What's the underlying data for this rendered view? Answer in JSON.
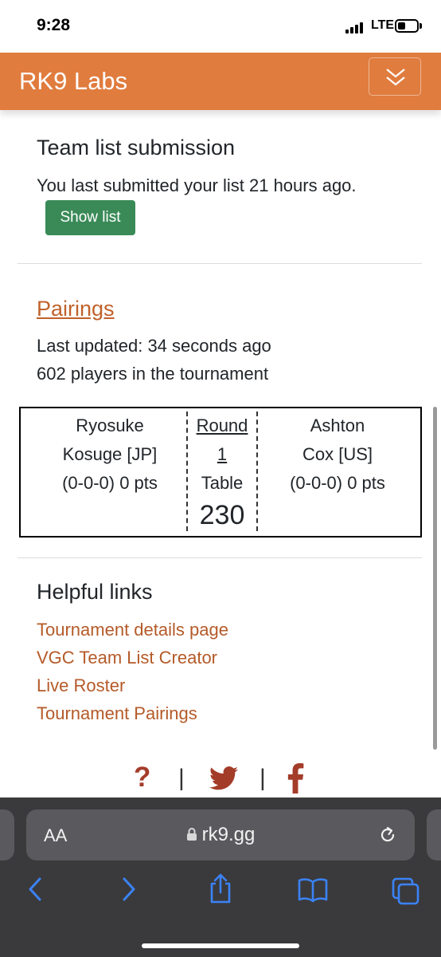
{
  "status": {
    "time": "9:28",
    "network": "LTE"
  },
  "navbar": {
    "brand": "RK9 Labs",
    "brand_color": "#e07c3e"
  },
  "team_list": {
    "heading": "Team list submission",
    "text": "You last submitted your list 21 hours ago.",
    "button_label": "Show list"
  },
  "pairings": {
    "heading": "Pairings",
    "updated": "Last updated: 34 seconds ago",
    "players": "602 players in the tournament",
    "match": {
      "player1": {
        "line1": "Ryosuke",
        "line2": "Kosuge [JP]",
        "record": "(0-0-0) 0 pts"
      },
      "round_label": "Round",
      "round_number": "1",
      "table_label": "Table",
      "table_number": "230",
      "player2": {
        "line1": "Ashton",
        "line2": "Cox [US]",
        "record": "(0-0-0) 0 pts"
      }
    }
  },
  "helpful_links": {
    "heading": "Helpful links",
    "links": [
      "Tournament details page",
      "VGC Team List Creator",
      "Live Roster",
      "Tournament Pairings"
    ]
  },
  "footer": {
    "question": "?",
    "separator": "|"
  },
  "browser": {
    "aa": "AA",
    "url": "rk9.gg"
  }
}
